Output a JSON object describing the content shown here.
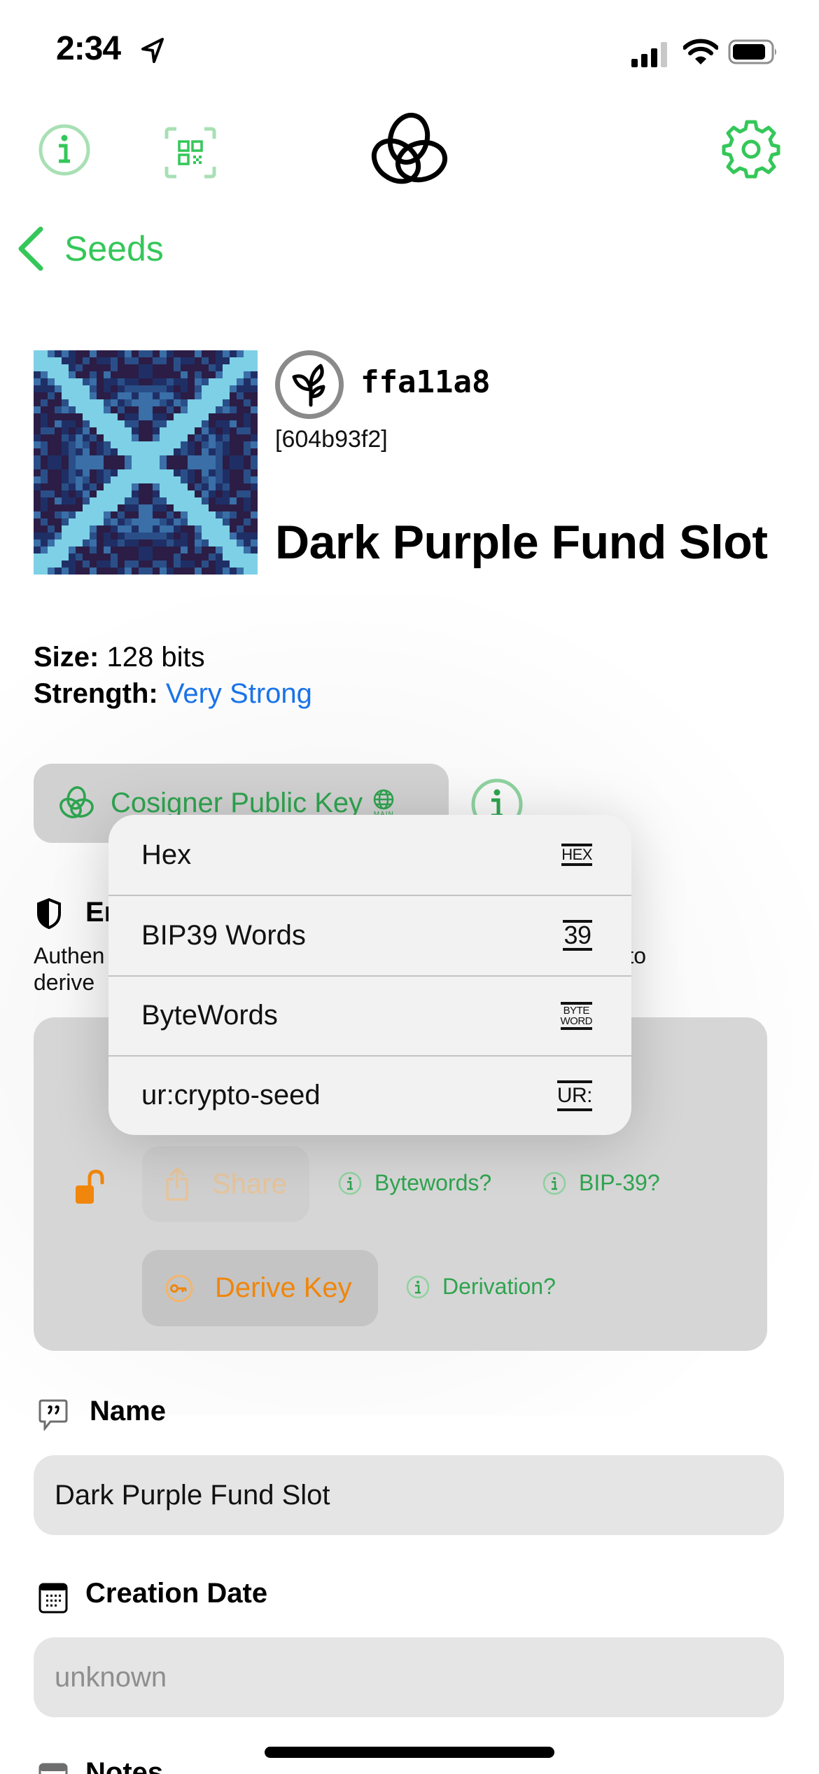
{
  "status_bar": {
    "time": "2:34",
    "icons": [
      "location-arrow-icon",
      "cellular-signal-icon",
      "wifi-icon",
      "battery-icon"
    ]
  },
  "nav": {
    "left_icons": [
      "info-icon",
      "qr-scan-icon"
    ],
    "center_logo": "blockchain-commons-logo",
    "right_icon": "gear-icon",
    "back_label": "Seeds"
  },
  "seed": {
    "fingerprint": "ffa11a8",
    "id": "[604b93f2]",
    "title": "Dark Purple Fund Slot",
    "size_label": "Size:",
    "size_value": "128 bits",
    "strength_label": "Strength:",
    "strength_value": "Very Strong"
  },
  "cosigner": {
    "label": "Cosigner Public Key",
    "network_badge": "MAIN"
  },
  "encryption": {
    "title_visible": "En",
    "desc_line1_visible": "Authen",
    "desc_line1_tail_visible": "to",
    "desc_line2_visible": "derive"
  },
  "actions": {
    "share_label": "Share",
    "bytewords_help": "Bytewords?",
    "bip39_help": "BIP-39?",
    "derive_label": "Derive Key",
    "derivation_help": "Derivation?"
  },
  "menu": {
    "items": [
      {
        "label": "Hex",
        "icon_text": "HEX",
        "icon": "hex-format-icon"
      },
      {
        "label": "BIP39 Words",
        "icon_text": "39",
        "icon": "bip39-format-icon"
      },
      {
        "label": "ByteWords",
        "icon_text": "BYTE WORD",
        "icon": "bytewords-format-icon"
      },
      {
        "label": "ur:crypto-seed",
        "icon_text": "UR:",
        "icon": "ur-format-icon"
      }
    ]
  },
  "fields": {
    "name_label": "Name",
    "name_value": "Dark Purple Fund Slot",
    "date_label": "Creation Date",
    "date_placeholder": "unknown",
    "notes_label": "Notes"
  },
  "colors": {
    "accent_green": "#34c759",
    "strength_blue": "#1a73e8",
    "derive_orange": "#f0860c"
  }
}
